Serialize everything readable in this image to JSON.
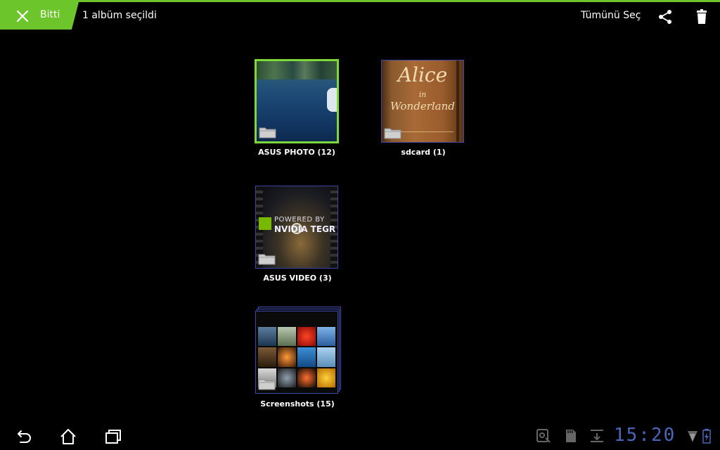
{
  "action_bar": {
    "done_label": "Bitti",
    "selection_title": "1 albüm seçildi",
    "select_all_label": "Tümünü Seç",
    "accent_color": "#6cc62b",
    "icons": [
      "close-icon",
      "share-icon",
      "trash-icon"
    ]
  },
  "albums": [
    {
      "label": "ASUS PHOTO (12)",
      "selected": true
    },
    {
      "label": "sdcard (1)",
      "selected": false
    },
    {
      "label": "ASUS VIDEO (3)",
      "selected": false
    },
    {
      "label": "Screenshots (15)",
      "selected": false
    }
  ],
  "thumb_text": {
    "book_title_1": "Alice",
    "book_title_2": "in",
    "book_title_3": "Wonderland",
    "video_line_1": "POWERED BY",
    "video_line_2": "NVIDIA TEGR"
  },
  "system_bar": {
    "clock": "15:20",
    "nav_icons": [
      "back-icon",
      "home-icon",
      "recent-apps-icon"
    ],
    "status_icons": [
      "usb-debug-icon",
      "sd-card-icon",
      "download-icon",
      "signal-icon",
      "battery-icon"
    ],
    "clock_color": "#4a66b8"
  }
}
